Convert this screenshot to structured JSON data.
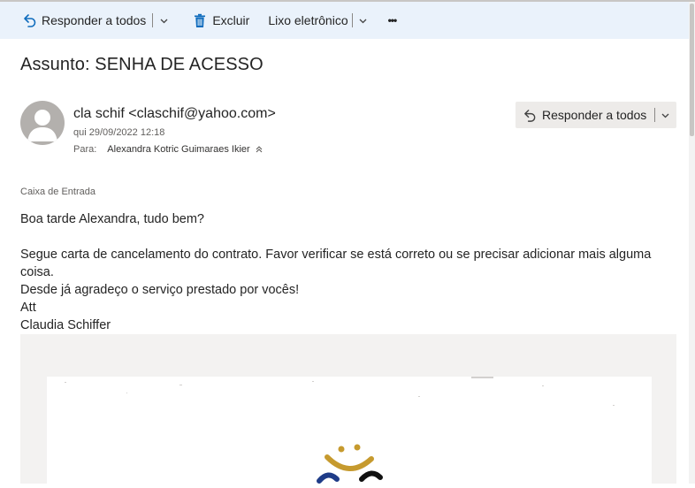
{
  "toolbar": {
    "reply_all_label": "Responder a todos",
    "delete_label": "Excluir",
    "junk_label": "Lixo eletrônico",
    "more_label": "•••"
  },
  "message": {
    "subject": "Assunto: SENHA DE ACESSO",
    "sender": "cla schif <claschif@yahoo.com>",
    "sent_time": "qui 29/09/2022 12:18",
    "to_label": "Para:",
    "to_name": "Alexandra Kotric Guimaraes Ikier",
    "reply_all_label": "Responder a todos",
    "folder": "Caixa de Entrada",
    "body": {
      "greeting": "Boa tarde Alexandra, tudo bem?",
      "line1": "Segue carta de cancelamento do contrato. Favor verificar se está correto ou se precisar adicionar mais alguma coisa.",
      "line2": "Desde já agradeço o serviço prestado por vocês!",
      "line3": "Att",
      "signature": "Claudia Schiffer"
    }
  },
  "icons": {
    "reply_all": "reply-all-icon",
    "delete": "trash-icon",
    "expand": "chevron-down-icon",
    "more": "more-icon",
    "avatar": "person-icon",
    "recipient_expand": "double-chevron-up-icon"
  },
  "colors": {
    "toolbar_bg": "#eaf2fb",
    "accent": "#0f6cbd",
    "logo_gold": "#c69a2e",
    "logo_blue": "#1f3c88"
  }
}
